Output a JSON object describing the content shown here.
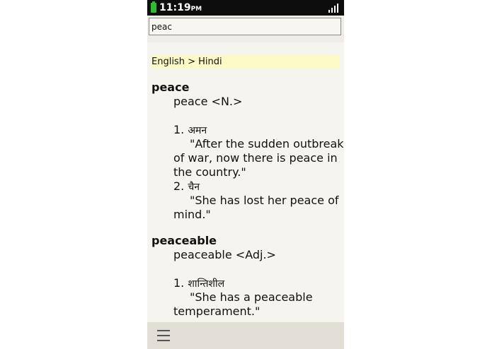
{
  "status_bar": {
    "time": "11:19",
    "ampm": "PM",
    "battery_icon": "battery-icon",
    "signal_icon": "signal-strength-icon"
  },
  "search": {
    "value": "peac",
    "placeholder": ""
  },
  "results": {
    "language_pair": "English > Hindi",
    "entries": [
      {
        "headword": "peace",
        "pos_line": "peace <N.>",
        "senses": [
          {
            "number": "1.",
            "hindi": "अमन",
            "example_lines": [
              "\"After the sudden outbreak",
              "of war, now there is peace in",
              "the country.\""
            ]
          },
          {
            "number": "2.",
            "hindi": "चैन",
            "example_lines": [
              "\"She has lost her peace of",
              "mind.\""
            ]
          }
        ]
      },
      {
        "headword": "peaceable",
        "pos_line": "peaceable <Adj.>",
        "senses": [
          {
            "number": "1.",
            "hindi": "शान्तिशील",
            "example_lines": [
              "\"She has a peaceable",
              "temperament.\""
            ]
          }
        ]
      }
    ]
  },
  "bottom_bar": {
    "menu_icon": "hamburger-menu-icon"
  },
  "colors": {
    "status_bar_bg": "#0d0d0d",
    "content_bg": "#f6f4ee",
    "language_banner_bg": "#fdfac6",
    "bottom_bar_bg": "#e1ded6",
    "battery": "#2bbd2b"
  }
}
